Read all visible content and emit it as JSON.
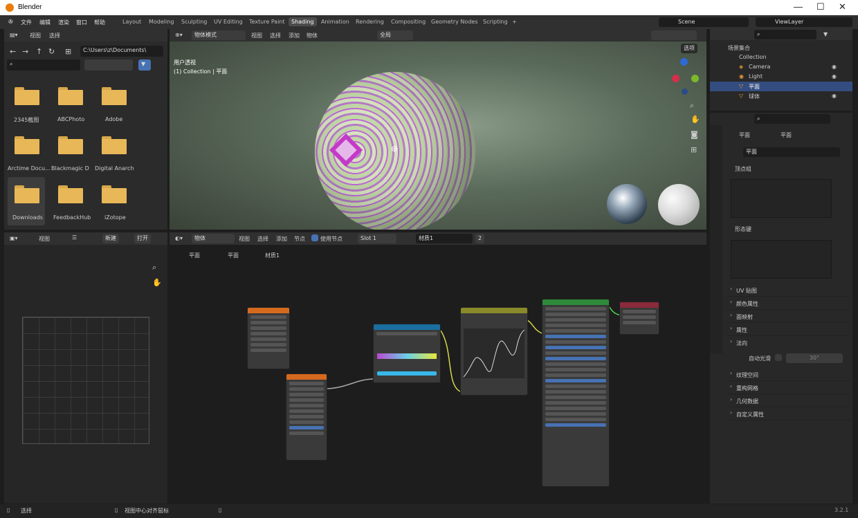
{
  "window": {
    "title": "Blender"
  },
  "menu": {
    "file": "文件",
    "edit": "编辑",
    "render": "渲染",
    "window": "窗口",
    "help": "帮助"
  },
  "workspaces": [
    "Layout",
    "Modeling",
    "Sculpting",
    "UV Editing",
    "Texture Paint",
    "Shading",
    "Animation",
    "Rendering",
    "Compositing",
    "Geometry Nodes",
    "Scripting"
  ],
  "scene": {
    "name": "Scene",
    "view_layer": "ViewLayer"
  },
  "file_browser": {
    "view": "视图",
    "select": "选择",
    "path": "C:\\Users\\z\\Documents\\",
    "folders": [
      "2345截图",
      "ABCPhoto",
      "Adobe",
      "Arctime Docu...",
      "Blackmagic D",
      "Digital Anarch",
      "Downloads",
      "FeedbackHub",
      "iZotope"
    ]
  },
  "viewport": {
    "mode": "物体模式",
    "view": "视图",
    "select": "选择",
    "add": "添加",
    "object": "物体",
    "orientation": "全局",
    "options": "选项",
    "overlay_line1": "用户透视",
    "overlay_line2": "(1) Collection | 平面"
  },
  "outliner": {
    "root": "场景集合",
    "collection": "Collection",
    "items": [
      "Camera",
      "Light",
      "平面",
      "球体"
    ]
  },
  "properties": {
    "breadcrumb_a": "平面",
    "breadcrumb_b": "平面",
    "mesh_name": "平面",
    "vertex_groups": "顶点组",
    "shape_keys": "形态键",
    "uv_maps": "UV 贴图",
    "color_attributes": "颜色属性",
    "face_maps": "面映射",
    "attributes": "属性",
    "normals": "法向",
    "auto_smooth": "自动光滑",
    "auto_smooth_angle": "30°",
    "texture_space": "纹理空间",
    "remesh": "重构网格",
    "geometry_data": "几何数据",
    "custom_props": "自定义属性"
  },
  "image_editor": {
    "view": "视图",
    "new": "新建",
    "open": "打开"
  },
  "node_editor": {
    "object": "物体",
    "view": "视图",
    "select": "选择",
    "add": "添加",
    "node": "节点",
    "use_nodes": "使用节点",
    "slot": "Slot 1",
    "material": "材质1",
    "users": "2",
    "crumb_obj": "平面",
    "crumb_mesh": "平面",
    "crumb_mat": "材质1"
  },
  "status": {
    "select": "选择",
    "center": "视图中心对齐鼠标",
    "version": "3.2.1"
  }
}
